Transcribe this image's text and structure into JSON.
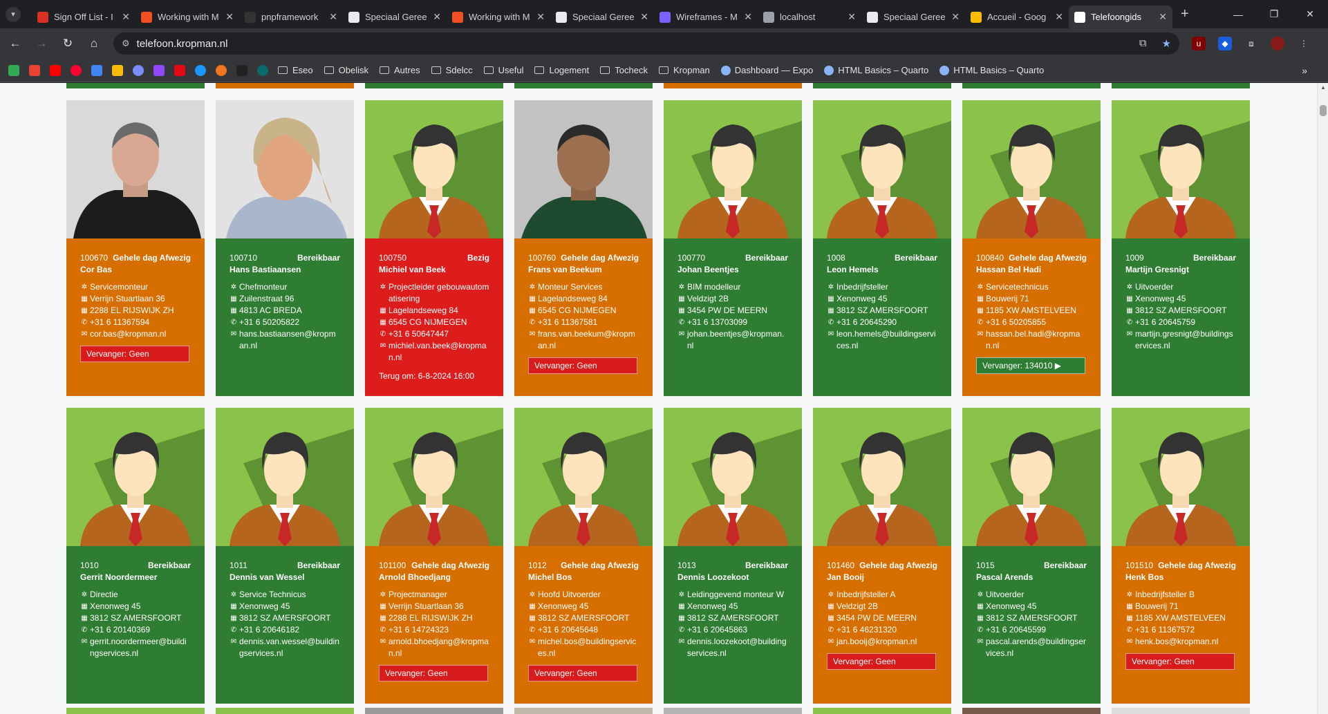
{
  "browser": {
    "tabs": [
      {
        "label": "Sign Off List - I",
        "icon": "red-doc-icon",
        "color": "#d93025"
      },
      {
        "label": "Working with M",
        "icon": "microsoft-icon",
        "color": "#f25022"
      },
      {
        "label": "pnpframework",
        "icon": "github-icon",
        "color": "#333333"
      },
      {
        "label": "Speciaal Geree",
        "icon": "doc-icon",
        "color": "#e8eaed"
      },
      {
        "label": "Working with M",
        "icon": "microsoft-icon",
        "color": "#f25022"
      },
      {
        "label": "Speciaal Geree",
        "icon": "doc-icon",
        "color": "#e8eaed"
      },
      {
        "label": "Wireframes - M",
        "icon": "miro-icon",
        "color": "#7b61ff"
      },
      {
        "label": "localhost",
        "icon": "globe-icon",
        "color": "#9aa0a6"
      },
      {
        "label": "Speciaal Geree",
        "icon": "doc-icon",
        "color": "#e8eaed"
      },
      {
        "label": "Accueil - Goog",
        "icon": "drive-icon",
        "color": "#fbbc04"
      },
      {
        "label": "Telefoongids",
        "icon": "k-logo-icon",
        "color": "#ffffff",
        "active": true
      }
    ],
    "url": "telefoon.kropman.nl",
    "bookmarks": [
      {
        "label": "Eseo",
        "type": "folder"
      },
      {
        "label": "Obelisk",
        "type": "folder"
      },
      {
        "label": "Autres",
        "type": "folder"
      },
      {
        "label": "Sdelcc",
        "type": "folder"
      },
      {
        "label": "Useful",
        "type": "folder"
      },
      {
        "label": "Logement",
        "type": "folder"
      },
      {
        "label": "Tocheck",
        "type": "folder"
      },
      {
        "label": "Kropman",
        "type": "folder"
      },
      {
        "label": "Dashboard — Expo",
        "type": "link"
      },
      {
        "label": "HTML Basics – Quarto",
        "type": "link"
      },
      {
        "label": "HTML Basics – Quarto",
        "type": "link"
      }
    ]
  },
  "status_colors": {
    "Bereikbaar": "#2e7d32",
    "Gehele dag Afwezig": "#d76e00",
    "Bezig": "#dd1c1c"
  },
  "cards": [
    {
      "number": "100670",
      "status": "Gehele dag Afwezig",
      "name": "Cor Bas",
      "role": "Servicemonteur",
      "address": "Verrijn Stuartlaan 36",
      "city": "2288 EL RIJSWIJK ZH",
      "phone": "+31 6 11367594",
      "email": "cor.bas@kropman.nl",
      "vervanger": "Vervanger: Geen",
      "color": "orange",
      "photo": "photo-man-gray"
    },
    {
      "number": "100710",
      "status": "Bereikbaar",
      "name": "Hans Bastiaansen",
      "role": "Chefmonteur",
      "address": "Zuilenstraat 96",
      "city": "4813 AC BREDA",
      "phone": "+31 6 50205822",
      "email": "hans.bastiaansen@kropman.nl",
      "color": "green",
      "photo": "photo-man-blond"
    },
    {
      "number": "100750",
      "status": "Bezig",
      "name": "Michiel van Beek",
      "role": "Projectleider gebouwautomatisering",
      "address": "Lagelandseweg 84",
      "city": "6545 CG NIJMEGEN",
      "phone": "+31 6 50647447",
      "email": "michiel.van.beek@kropman.nl",
      "terug": "Terug om: 6-8-2024 16:00",
      "color": "red",
      "photo": "avatar"
    },
    {
      "number": "100760",
      "status": "Gehele dag Afwezig",
      "name": "Frans van Beekum",
      "role": "Monteur Services",
      "address": "Lagelandseweg 84",
      "city": "6545 CG NIJMEGEN",
      "phone": "+31 6 11367581",
      "email": "frans.van.beekum@kropman.nl",
      "vervanger": "Vervanger: Geen",
      "color": "orange",
      "photo": "photo-man-dark"
    },
    {
      "number": "100770",
      "status": "Bereikbaar",
      "name": "Johan Beentjes",
      "role": "BIM modelleur",
      "address": "Veldzigt 2B",
      "city": "3454 PW DE MEERN",
      "phone": "+31 6 13703099",
      "email": "johan.beentjes@kropman.nl",
      "color": "green",
      "photo": "avatar"
    },
    {
      "number": "1008",
      "status": "Bereikbaar",
      "name": "Leon Hemels",
      "role": "Inbedrijfsteller",
      "address": "Xenonweg 45",
      "city": "3812 SZ AMERSFOORT",
      "phone": "+31 6 20645290",
      "email": "leon.hemels@buildingservices.nl",
      "color": "green",
      "photo": "avatar"
    },
    {
      "number": "100840",
      "status": "Gehele dag Afwezig",
      "name": "Hassan Bel Hadi",
      "role": "Servicetechnicus",
      "address": "Bouwerij 71",
      "city": "1185 XW AMSTELVEEN",
      "phone": "+31 6 50205855",
      "email": "hassan.bel.hadi@kropman.nl",
      "vervanger": "Vervanger: 134010 ▶",
      "vervanger_color": "green",
      "color": "orange",
      "photo": "avatar"
    },
    {
      "number": "1009",
      "status": "Bereikbaar",
      "name": "Martijn Gresnigt",
      "role": "Uitvoerder",
      "address": "Xenonweg 45",
      "city": "3812 SZ AMERSFOORT",
      "phone": "+31 6 20645759",
      "email": "martijn.gresnigt@buildingservices.nl",
      "color": "green",
      "photo": "avatar"
    },
    {
      "number": "1010",
      "status": "Bereikbaar",
      "name": "Gerrit Noordermeer",
      "role": "Directie",
      "address": "Xenonweg 45",
      "city": "3812 SZ AMERSFOORT",
      "phone": "+31 6 20140369",
      "email": "gerrit.noordermeer@buildingservices.nl",
      "color": "green",
      "photo": "avatar"
    },
    {
      "number": "1011",
      "status": "Bereikbaar",
      "name": "Dennis van Wessel",
      "role": "Service Technicus",
      "address": "Xenonweg 45",
      "city": "3812 SZ AMERSFOORT",
      "phone": "+31 6 20646182",
      "email": "dennis.van.wessel@buildingservices.nl",
      "color": "green",
      "photo": "avatar"
    },
    {
      "number": "101100",
      "status": "Gehele dag Afwezig",
      "name": "Arnold Bhoedjang",
      "role": "Projectmanager",
      "address": "Verrijn Stuartlaan 36",
      "city": "2288 EL RIJSWIJK ZH",
      "phone": "+31 6 14724323",
      "email": "arnold.bhoedjang@kropman.nl",
      "vervanger": "Vervanger: Geen",
      "color": "orange",
      "photo": "avatar"
    },
    {
      "number": "1012",
      "status": "Gehele dag Afwezig",
      "name": "Michel Bos",
      "role": "Hoofd Uitvoerder",
      "address": "Xenonweg 45",
      "city": "3812 SZ AMERSFOORT",
      "phone": "+31 6 20645648",
      "email": "michel.bos@buildingservices.nl",
      "vervanger": "Vervanger: Geen",
      "color": "orange",
      "photo": "avatar"
    },
    {
      "number": "1013",
      "status": "Bereikbaar",
      "name": "Dennis Loozekoot",
      "role": "Leidinggevend monteur W",
      "address": "Xenonweg 45",
      "city": "3812 SZ AMERSFOORT",
      "phone": "+31 6 20645863",
      "email": "dennis.loozekoot@buildingservices.nl",
      "color": "green",
      "photo": "avatar"
    },
    {
      "number": "101460",
      "status": "Gehele dag Afwezig",
      "name": "Jan Booij",
      "role": "Inbedrijfsteller A",
      "address": "Veldzigt 2B",
      "city": "3454 PW DE MEERN",
      "phone": "+31 6 46231320",
      "email": "jan.booij@kropman.nl",
      "vervanger": "Vervanger: Geen",
      "color": "orange",
      "photo": "avatar"
    },
    {
      "number": "1015",
      "status": "Bereikbaar",
      "name": "Pascal Arends",
      "role": "Uitvoerder",
      "address": "Xenonweg 45",
      "city": "3812 SZ AMERSFOORT",
      "phone": "+31 6 20645599",
      "email": "pascal.arends@buildingservices.nl",
      "color": "green",
      "photo": "avatar"
    },
    {
      "number": "101510",
      "status": "Gehele dag Afwezig",
      "name": "Henk Bos",
      "role": "Inbedrijfsteller B",
      "address": "Bouwerij 71",
      "city": "1185 XW AMSTELVEEN",
      "phone": "+31 6 11367572",
      "email": "henk.bos@kropman.nl",
      "vervanger": "Vervanger: Geen",
      "color": "orange",
      "photo": "avatar"
    }
  ],
  "top_stub_colors": [
    "green",
    "orange",
    "green",
    "green",
    "orange",
    "green",
    "green",
    "green"
  ]
}
